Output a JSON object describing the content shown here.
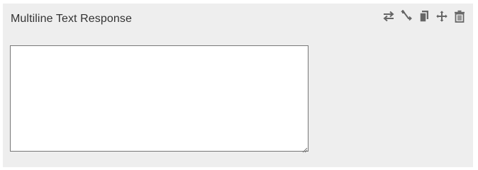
{
  "question": {
    "title": "Multiline Text Response",
    "answer_value": "",
    "answer_placeholder": ""
  },
  "toolbar": {
    "icons": [
      "swap-icon",
      "branch-icon",
      "copy-icon",
      "move-icon",
      "trash-icon"
    ],
    "icon_color": "#666666"
  },
  "colors": {
    "panel_background": "#eeeeee",
    "text_primary": "#333333",
    "input_border": "#777777"
  }
}
